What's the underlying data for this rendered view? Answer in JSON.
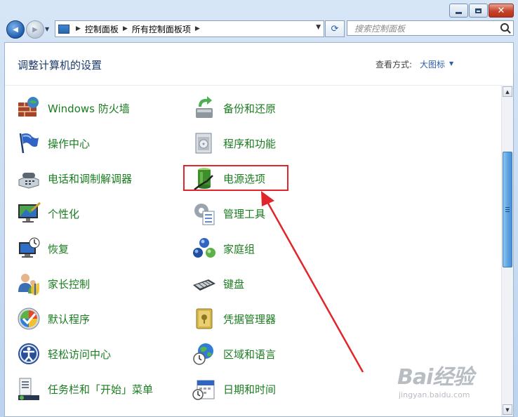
{
  "window": {
    "minimize_icon": "minimize-icon",
    "maximize_icon": "maximize-icon",
    "close_label": "✕"
  },
  "nav": {
    "back_glyph": "◀",
    "forward_glyph": "▶",
    "history_glyph": "▼",
    "breadcrumbs": [
      "控制面板",
      "所有控制面板项"
    ],
    "crumb_separator": "▶",
    "refresh_glyph": "⟳",
    "search_placeholder": "搜索控制面板"
  },
  "header": {
    "title": "调整计算机的设置",
    "view_by_label": "查看方式:",
    "view_by_value": "大图标",
    "view_arrow": "▼"
  },
  "items": {
    "col1": [
      {
        "label": "Windows 防火墙",
        "icon": "firewall-icon"
      },
      {
        "label": "操作中心",
        "icon": "action-center-flag-icon"
      },
      {
        "label": "电话和调制解调器",
        "icon": "phone-modem-icon"
      },
      {
        "label": "个性化",
        "icon": "personalization-icon"
      },
      {
        "label": "恢复",
        "icon": "recovery-icon"
      },
      {
        "label": "家长控制",
        "icon": "parental-controls-icon"
      },
      {
        "label": "默认程序",
        "icon": "default-programs-icon"
      },
      {
        "label": "轻松访问中心",
        "icon": "ease-of-access-icon"
      },
      {
        "label": "任务栏和「开始」菜单",
        "icon": "taskbar-start-menu-icon"
      }
    ],
    "col2": [
      {
        "label": "备份和还原",
        "icon": "backup-restore-icon"
      },
      {
        "label": "程序和功能",
        "icon": "programs-features-icon"
      },
      {
        "label": "电源选项",
        "icon": "power-options-icon"
      },
      {
        "label": "管理工具",
        "icon": "admin-tools-icon"
      },
      {
        "label": "家庭组",
        "icon": "homegroup-icon"
      },
      {
        "label": "键盘",
        "icon": "keyboard-icon"
      },
      {
        "label": "凭据管理器",
        "icon": "credential-manager-icon"
      },
      {
        "label": "区域和语言",
        "icon": "region-language-icon"
      },
      {
        "label": "日期和时间",
        "icon": "date-time-icon"
      }
    ]
  },
  "scrollbar": {
    "up_glyph": "▲",
    "down_glyph": "▼"
  },
  "annotation": {
    "color": "#e0262b"
  },
  "watermark": {
    "logo": "Bai经验",
    "sub": "jingyan.baidu.com"
  }
}
